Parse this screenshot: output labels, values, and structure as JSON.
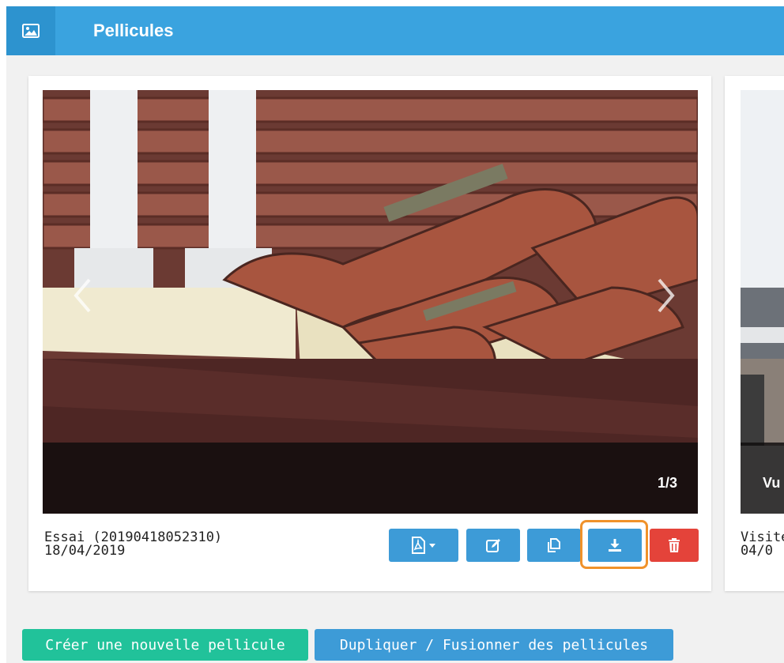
{
  "header": {
    "title": "Pellicules",
    "icon": "image-icon"
  },
  "cards": [
    {
      "counter": "1/3",
      "name": "Essai (20190418052310)",
      "date": "18/04/2019"
    },
    {
      "caption": "Vu",
      "name": "Visite",
      "date": "04/0"
    }
  ],
  "actions": [
    "pdf-icon",
    "edit-icon",
    "copy-icon",
    "download-icon",
    "trash-icon"
  ],
  "buttons": {
    "create": "Créer une nouvelle pellicule",
    "duplicate": "Dupliquer / Fusionner des pellicules"
  },
  "colors": {
    "header": "#3aa3df",
    "button_blue": "#3d9bd7",
    "button_red": "#e4433a",
    "button_green": "#21c29a",
    "focus_ring": "#f0922b"
  }
}
